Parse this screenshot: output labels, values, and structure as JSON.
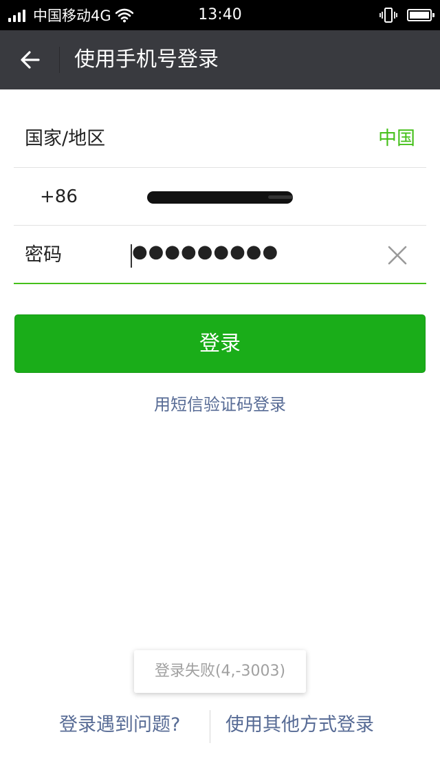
{
  "status_bar": {
    "carrier": "中国移动4G",
    "time": "13:40"
  },
  "app_bar": {
    "back_icon": "back-arrow-icon",
    "title": "使用手机号登录"
  },
  "form": {
    "country_label": "国家/地区",
    "country_value": "中国",
    "phone_prefix": "+86",
    "phone_value_redacted": true,
    "password_label": "密码",
    "password_value": "●●●●●●●●●",
    "clear_icon": "close-icon"
  },
  "login_button": "登录",
  "sms_login_link": "用短信验证码登录",
  "toast": "登录失败(4,-3003)",
  "bottom_links": {
    "problem": "登录遇到问题?",
    "other_methods": "使用其他方式登录"
  },
  "colors": {
    "accent_green": "#1aad19",
    "link_blue": "#576b95",
    "app_bar": "#393a3f"
  }
}
